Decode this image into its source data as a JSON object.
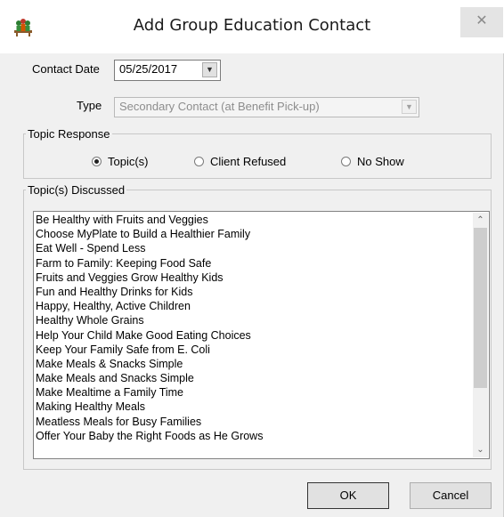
{
  "window": {
    "title": "Add Group Education Contact",
    "app_icon": "people-group-icon",
    "close_label": "✕"
  },
  "form": {
    "contact_date_label": "Contact Date",
    "contact_date_value": "05/25/2017",
    "type_label": "Type",
    "type_value": "Secondary Contact (at Benefit Pick-up)"
  },
  "topic_response": {
    "legend": "Topic Response",
    "options": [
      {
        "label": "Topic(s)",
        "checked": true
      },
      {
        "label": "Client Refused",
        "checked": false
      },
      {
        "label": "No Show",
        "checked": false
      }
    ]
  },
  "topics_discussed": {
    "legend": "Topic(s) Discussed",
    "items": [
      "Be Healthy with Fruits and Veggies",
      "Choose MyPlate to Build a Healthier Family",
      "Eat Well - Spend Less",
      "Farm to Family: Keeping Food Safe",
      "Fruits and Veggies Grow Healthy Kids",
      "Fun and Healthy Drinks for Kids",
      "Happy, Healthy, Active Children",
      "Healthy Whole Grains",
      "Help Your Child Make Good Eating Choices",
      "Keep Your Family Safe from E. Coli",
      "Make Meals & Snacks Simple",
      "Make Meals and Snacks Simple",
      "Make Mealtime a Family Time",
      "Making Healthy Meals",
      "Meatless Meals for Busy Families",
      "Offer Your Baby the Right Foods as He Grows"
    ]
  },
  "buttons": {
    "ok": "OK",
    "cancel": "Cancel"
  },
  "colors": {
    "dialog_bg": "#f0f0f0",
    "titlebar_bg": "#ffffff",
    "disabled_text": "#8d8d8d"
  }
}
